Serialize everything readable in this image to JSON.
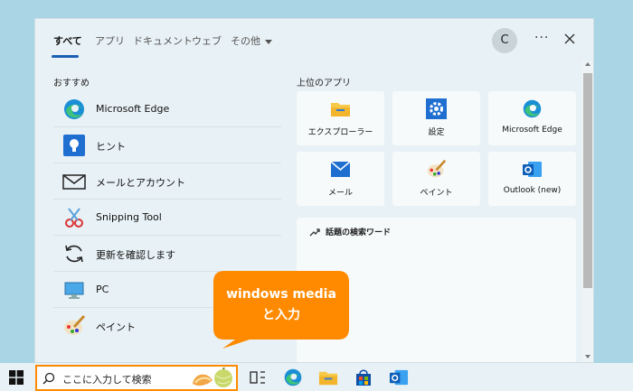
{
  "start_panel": {
    "tabs": [
      {
        "label": "すべて",
        "active": true
      },
      {
        "label": "アプリ"
      },
      {
        "label": "ドキュメント"
      },
      {
        "label": "ウェブ"
      },
      {
        "label": "その他"
      }
    ],
    "avatar_letter": "C",
    "more_label": "···"
  },
  "recommended": {
    "heading": "おすすめ",
    "items": [
      {
        "label": "Microsoft Edge",
        "icon": "edge-icon"
      },
      {
        "label": "ヒント",
        "icon": "tips-icon"
      },
      {
        "label": "メールとアカウント",
        "icon": "mail-envelope-icon"
      },
      {
        "label": "Snipping Tool",
        "icon": "snipping-tool-icon"
      },
      {
        "label": "更新を確認します",
        "icon": "refresh-icon"
      },
      {
        "label": "PC",
        "icon": "pc-icon"
      },
      {
        "label": "ペイント",
        "icon": "paint-icon"
      }
    ]
  },
  "top_apps": {
    "heading": "上位のアプリ",
    "tiles": [
      {
        "label": "エクスプローラー",
        "icon": "file-explorer-icon"
      },
      {
        "label": "設定",
        "icon": "settings-gear-icon"
      },
      {
        "label": "Microsoft Edge",
        "icon": "edge-icon"
      },
      {
        "label": "メール",
        "icon": "mail-icon"
      },
      {
        "label": "ペイント",
        "icon": "paint-icon"
      },
      {
        "label": "Outlook (new)",
        "icon": "outlook-icon"
      }
    ]
  },
  "trending": {
    "title": "話題の検索ワード"
  },
  "taskbar": {
    "search_placeholder": "ここに入力して検索"
  },
  "callout": {
    "line1": "windows media",
    "line2": "と入力",
    "color": "#ff8a00"
  },
  "colors": {
    "desktop": "#a9d5e4",
    "panel": "#e8f1f5",
    "accent": "#1a5fb4",
    "highlight": "#ff8a00"
  }
}
